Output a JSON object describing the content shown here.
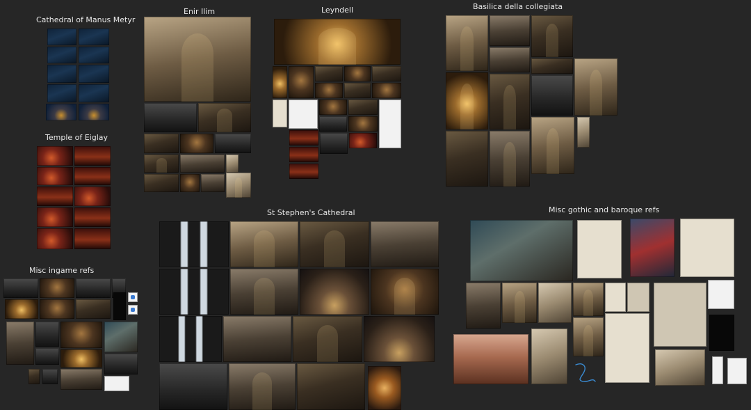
{
  "board": {
    "groups": {
      "manus": {
        "title": "Cathedral of Manus Metyr"
      },
      "enir": {
        "title": "Enir Ilim"
      },
      "leyndell": {
        "title": "Leyndell"
      },
      "basilica": {
        "title": "Basilica della collegiata"
      },
      "eiglay": {
        "title": "Temple of Eiglay"
      },
      "ingame": {
        "title": "Misc ingame refs"
      },
      "stephen": {
        "title": "St Stephen's Cathedral"
      },
      "misc_gothic": {
        "title": "Misc gothic and baroque refs"
      }
    }
  },
  "colors": {
    "background": "#262626",
    "label_text": "#e8e8e8",
    "sketch_curl": "#3a8ad0"
  }
}
